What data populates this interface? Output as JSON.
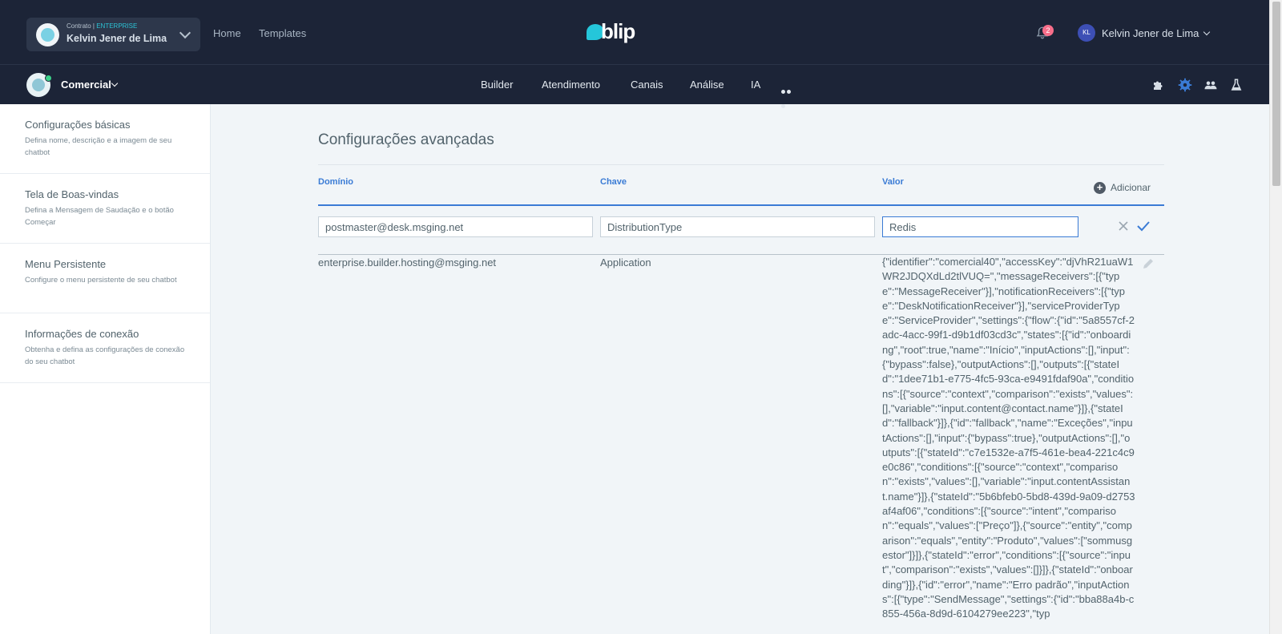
{
  "header": {
    "contract_prefix": "Contrato | ",
    "contract_plan": "ENTERPRISE",
    "contract_name": "Kelvin Jener de Lima",
    "nav": [
      "Home",
      "Templates"
    ],
    "brand": "blip",
    "notification_count": "2",
    "user_initials": "KL",
    "user_name": "Kelvin Jener de Lima"
  },
  "subheader": {
    "bot_name": "Comercial",
    "nav": [
      "Builder",
      "Atendimento",
      "Canais",
      "Análise",
      "IA"
    ],
    "tools": [
      "puzzle-icon",
      "gear-icon",
      "team-icon",
      "flask-icon"
    ]
  },
  "sidebar": {
    "items": [
      {
        "title": "Configurações básicas",
        "desc": "Defina nome, descrição e a imagem de seu chatbot"
      },
      {
        "title": "Tela de Boas-vindas",
        "desc": "Defina a Mensagem de Saudação e o botão Começar"
      },
      {
        "title": "Menu Persistente",
        "desc": "Configure o menu persistente de seu chatbot"
      },
      {
        "title": "Informações de conexão",
        "desc": "Obtenha e defina as configurações de conexão do seu chatbot"
      }
    ]
  },
  "main": {
    "title": "Configurações avançadas",
    "columns": {
      "domain": "Domínio",
      "key": "Chave",
      "value": "Valor"
    },
    "add_label": "Adicionar",
    "form": {
      "domain": "postmaster@desk.msging.net",
      "key": "DistributionType",
      "value": "Redis"
    },
    "rows": [
      {
        "domain": "enterprise.builder.hosting@msging.net",
        "key": "Application",
        "value": "{\"identifier\":\"comercial40\",\"accessKey\":\"djVhR21uaW1WR2JDQXdLd2tlVUQ=\",\"messageReceivers\":[{\"type\":\"MessageReceiver\"}],\"notificationReceivers\":[{\"type\":\"DeskNotificationReceiver\"}],\"serviceProviderType\":\"ServiceProvider\",\"settings\":{\"flow\":{\"id\":\"5a8557cf-2adc-4acc-99f1-d9b1df03cd3c\",\"states\":[{\"id\":\"onboarding\",\"root\":true,\"name\":\"Início\",\"inputActions\":[],\"input\":{\"bypass\":false},\"outputActions\":[],\"outputs\":[{\"stateId\":\"1dee71b1-e775-4fc5-93ca-e9491fdaf90a\",\"conditions\":[{\"source\":\"context\",\"comparison\":\"exists\",\"values\":[],\"variable\":\"input.content@contact.name\"}]},{\"stateId\":\"fallback\"}]},{\"id\":\"fallback\",\"name\":\"Exceções\",\"inputActions\":[],\"input\":{\"bypass\":true},\"outputActions\":[],\"outputs\":[{\"stateId\":\"c7e1532e-a7f5-461e-bea4-221c4c9e0c86\",\"conditions\":[{\"source\":\"context\",\"comparison\":\"exists\",\"values\":[],\"variable\":\"input.contentAssistant.name\"}]},{\"stateId\":\"5b6bfeb0-5bd8-439d-9a09-d2753af4af06\",\"conditions\":[{\"source\":\"intent\",\"comparison\":\"equals\",\"values\":[\"Preço\"]},{\"source\":\"entity\",\"comparison\":\"equals\",\"entity\":\"Produto\",\"values\":[\"sommusgestor\"]}]},{\"stateId\":\"error\",\"conditions\":[{\"source\":\"input\",\"comparison\":\"exists\",\"values\":[]}]},{\"stateId\":\"onboarding\"}]},{\"id\":\"error\",\"name\":\"Erro padrão\",\"inputActions\":[{\"type\":\"SendMessage\",\"settings\":{\"id\":\"bba88a4b-c855-456a-8d9d-6104279ee223\",\"typ"
      }
    ]
  }
}
